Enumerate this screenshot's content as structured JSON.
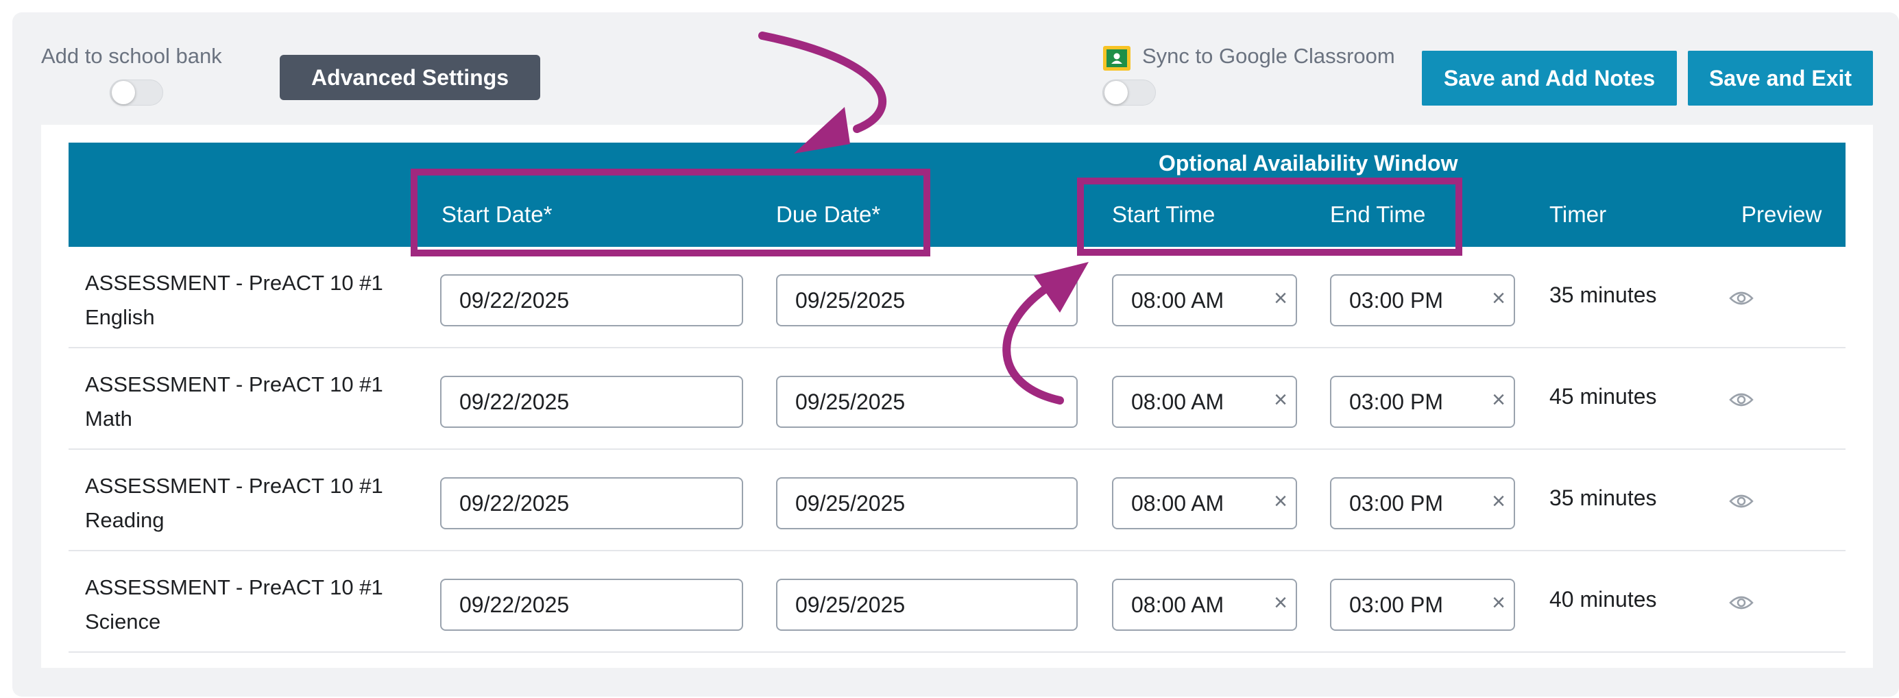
{
  "toolbar": {
    "school_bank_label": "Add to school bank",
    "advanced_settings_label": "Advanced Settings",
    "sync_label": "Sync to Google Classroom",
    "save_add_notes_label": "Save and Add Notes",
    "save_exit_label": "Save and Exit"
  },
  "table": {
    "group_header": "Optional Availability Window",
    "columns": {
      "start_date": "Start Date*",
      "due_date": "Due Date*",
      "start_time": "Start Time",
      "end_time": "End Time",
      "timer": "Timer",
      "preview": "Preview"
    },
    "rows": [
      {
        "name_line1": "ASSESSMENT - PreACT 10 #1",
        "name_line2": "English",
        "start_date": "09/22/2025",
        "due_date": "09/25/2025",
        "start_time": "08:00 AM",
        "end_time": "03:00 PM",
        "timer": "35 minutes"
      },
      {
        "name_line1": "ASSESSMENT - PreACT 10 #1",
        "name_line2": "Math",
        "start_date": "09/22/2025",
        "due_date": "09/25/2025",
        "start_time": "08:00 AM",
        "end_time": "03:00 PM",
        "timer": "45 minutes"
      },
      {
        "name_line1": "ASSESSMENT - PreACT 10 #1",
        "name_line2": "Reading",
        "start_date": "09/22/2025",
        "due_date": "09/25/2025",
        "start_time": "08:00 AM",
        "end_time": "03:00 PM",
        "timer": "35 minutes"
      },
      {
        "name_line1": "ASSESSMENT - PreACT 10 #1",
        "name_line2": "Science",
        "start_date": "09/22/2025",
        "due_date": "09/25/2025",
        "start_time": "08:00 AM",
        "end_time": "03:00 PM",
        "timer": "40 minutes"
      }
    ],
    "clear_glyph": "×"
  },
  "icons": {
    "google_classroom": "google-classroom-icon",
    "preview": "eye-icon",
    "clear": "close-icon"
  },
  "colors": {
    "header_bg": "#037ba3",
    "button_blue": "#1090ba",
    "button_dark": "#4c5563",
    "annotation": "#a0287f"
  }
}
